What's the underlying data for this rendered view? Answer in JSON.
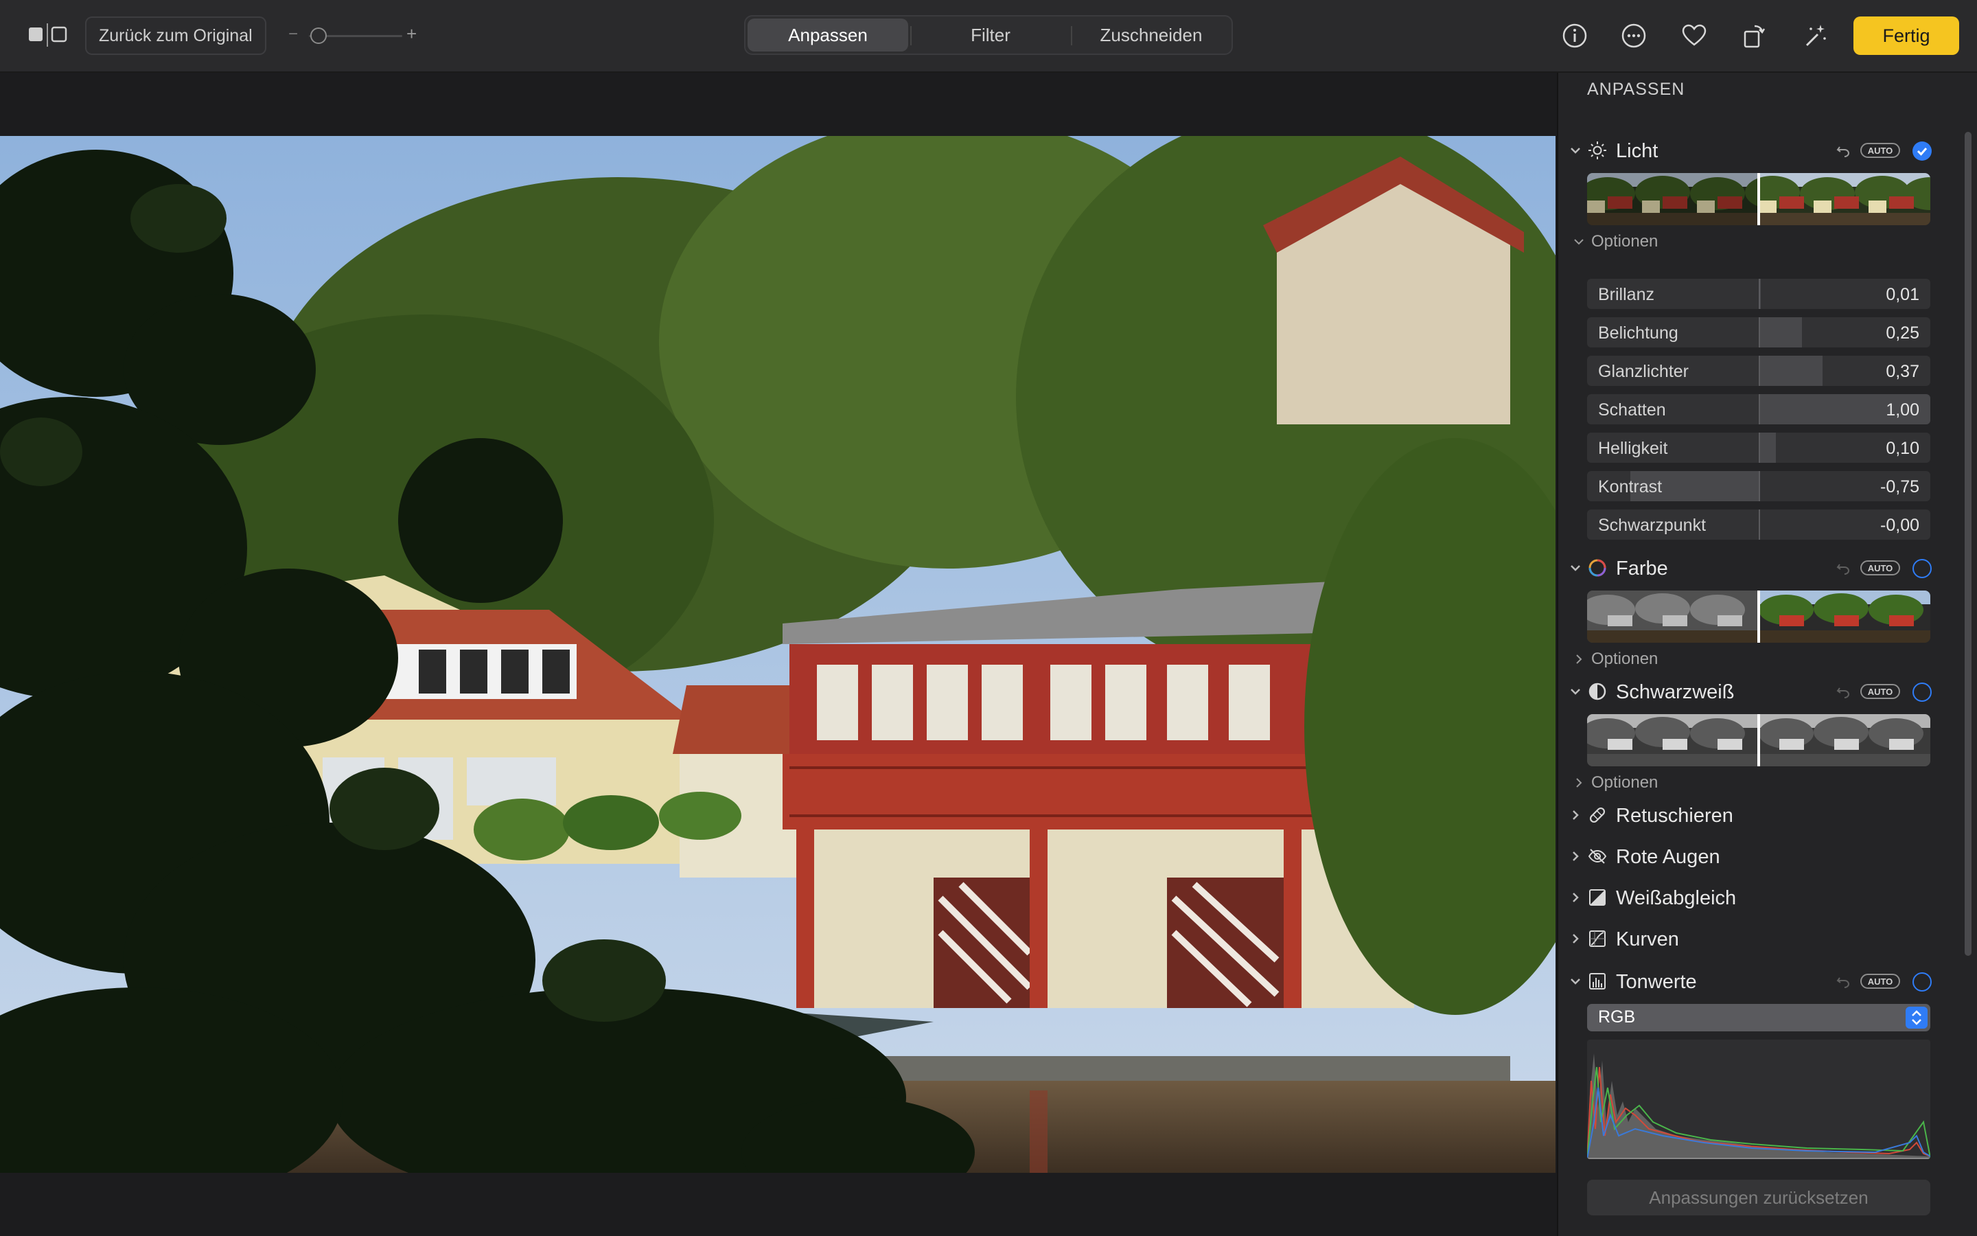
{
  "toolbar": {
    "revert_label": "Zurück zum Original",
    "zoom_minus": "−",
    "zoom_plus": "+",
    "tabs": [
      {
        "label": "Anpassen",
        "active": true
      },
      {
        "label": "Filter",
        "active": false
      },
      {
        "label": "Zuschneiden",
        "active": false
      }
    ],
    "done_label": "Fertig",
    "accent": "#f5c520"
  },
  "sidebar": {
    "title": "ANPASSEN",
    "auto_label": "AUTO",
    "options_label": "Optionen",
    "accent": "#2f7cf6",
    "sections": {
      "licht": {
        "name": "Licht",
        "enabled": true
      },
      "farbe": {
        "name": "Farbe",
        "enabled": false
      },
      "schwarzweiss": {
        "name": "Schwarzweiß",
        "enabled": false
      },
      "retuschieren": {
        "name": "Retuschieren"
      },
      "rote_augen": {
        "name": "Rote Augen"
      },
      "weissabgleich": {
        "name": "Weißabgleich"
      },
      "kurven": {
        "name": "Kurven"
      },
      "tonwerte": {
        "name": "Tonwerte",
        "enabled": false
      }
    },
    "licht_sliders": [
      {
        "label": "Brillanz",
        "value": "0,01",
        "amount": 0.01
      },
      {
        "label": "Belichtung",
        "value": "0,25",
        "amount": 0.25
      },
      {
        "label": "Glanzlichter",
        "value": "0,37",
        "amount": 0.37
      },
      {
        "label": "Schatten",
        "value": "1,00",
        "amount": 1.0
      },
      {
        "label": "Helligkeit",
        "value": "0,10",
        "amount": 0.1
      },
      {
        "label": "Kontrast",
        "value": "-0,75",
        "amount": -0.75
      },
      {
        "label": "Schwarzpunkt",
        "value": "-0,00",
        "amount": 0.0
      }
    ],
    "tonwerte_channel": "RGB",
    "reset_label": "Anpassungen zurücksetzen"
  }
}
